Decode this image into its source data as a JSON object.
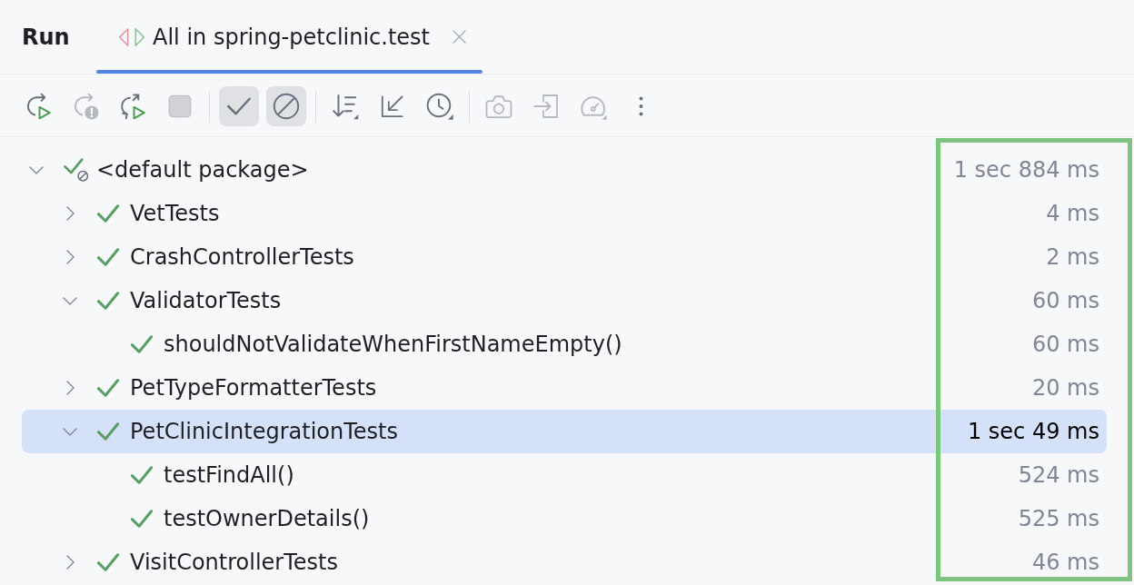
{
  "header": {
    "title": "Run",
    "tabs": [
      {
        "label": "All in spring-petclinic.test",
        "selected": true,
        "closable": true
      }
    ]
  },
  "toolbar": [
    {
      "kind": "rerun",
      "disabled": false
    },
    {
      "kind": "retry",
      "disabled": true
    },
    {
      "kind": "autotest",
      "disabled": false
    },
    {
      "kind": "stop",
      "disabled": true
    },
    {
      "kind": "separator"
    },
    {
      "kind": "passed",
      "selected": true
    },
    {
      "kind": "ignored",
      "selected": true
    },
    {
      "kind": "separator"
    },
    {
      "kind": "sort",
      "disabled": false
    },
    {
      "kind": "collapse",
      "disabled": false
    },
    {
      "kind": "history",
      "disabled": false
    },
    {
      "kind": "separator"
    },
    {
      "kind": "snapshot",
      "disabled": true
    },
    {
      "kind": "import",
      "disabled": true
    },
    {
      "kind": "coverage",
      "disabled": true
    },
    {
      "kind": "more",
      "disabled": false
    }
  ],
  "tree": {
    "duration_column_highlighted": true,
    "nodes": [
      {
        "label": "<default package>",
        "duration": "1 sec 884 ms",
        "passed": true,
        "ignored": true,
        "expanded": true,
        "selected": false,
        "children": [
          {
            "label": "VetTests",
            "duration": "4 ms",
            "passed": true,
            "ignored": false,
            "expanded": false,
            "selected": false
          },
          {
            "label": "CrashControllerTests",
            "duration": "2 ms",
            "passed": true,
            "ignored": false,
            "expanded": false,
            "selected": false
          },
          {
            "label": "ValidatorTests",
            "duration": "60 ms",
            "passed": true,
            "ignored": false,
            "expanded": true,
            "selected": false,
            "children": [
              {
                "label": "shouldNotValidateWhenFirstNameEmpty()",
                "duration": "60 ms",
                "passed": true,
                "ignored": false,
                "selected": false
              }
            ]
          },
          {
            "label": "PetTypeFormatterTests",
            "duration": "20 ms",
            "passed": true,
            "ignored": false,
            "expanded": false,
            "selected": false
          },
          {
            "label": "PetClinicIntegrationTests",
            "duration": "1 sec 49 ms",
            "passed": true,
            "ignored": false,
            "expanded": true,
            "selected": true,
            "children": [
              {
                "label": "testFindAll()",
                "duration": "524 ms",
                "passed": true,
                "ignored": false,
                "selected": false
              },
              {
                "label": "testOwnerDetails()",
                "duration": "525 ms",
                "passed": true,
                "ignored": false,
                "selected": false
              }
            ]
          },
          {
            "label": "VisitControllerTests",
            "duration": "46 ms",
            "passed": true,
            "ignored": false,
            "expanded": false,
            "selected": false
          }
        ]
      }
    ]
  }
}
